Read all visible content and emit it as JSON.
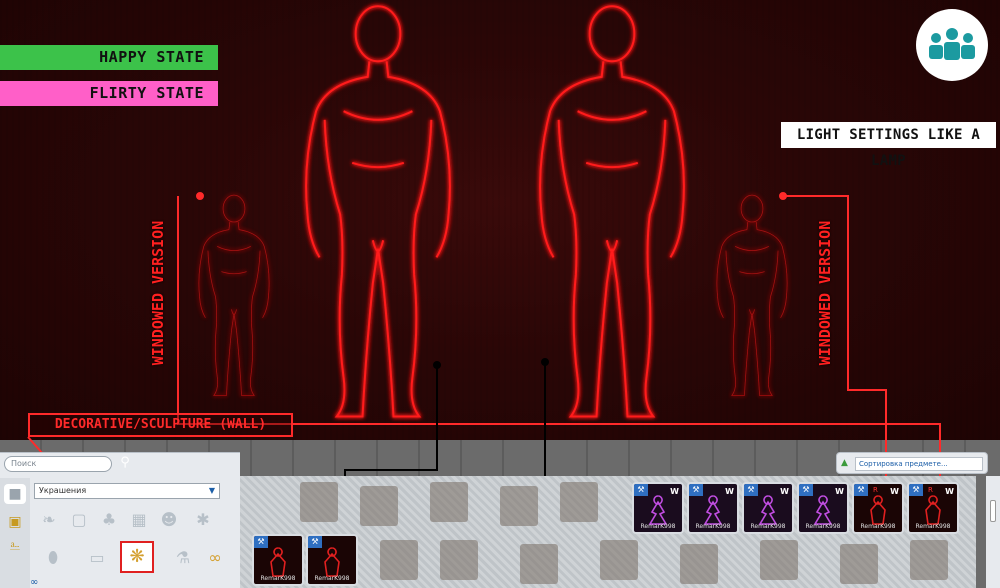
{
  "labels": {
    "happy": "HAPPY STATE",
    "flirty": "FLIRTY STATE",
    "light": "LIGHT SETTINGS LIKE A LAMP",
    "windowed_left": "WINDOWED VERSION",
    "windowed_right": "WINDOWED VERSION",
    "decorative": "DECORATIVE/SCULPTURE (WALL)"
  },
  "colors": {
    "happy": "#3cc24a",
    "flirty": "#ff5fc8",
    "neon": "#ff1a1a",
    "logo": "#1c9aa0"
  },
  "build_panel": {
    "search_placeholder": "Поиск",
    "search_icon": "search-icon",
    "category": "Украшения",
    "sort_placeholder": "Сортировка предмете...",
    "bottom_symbol": "∞"
  },
  "catalog_cards": [
    {
      "creator": "RemarK998",
      "tag": "W",
      "style": "purple"
    },
    {
      "creator": "RemarK998",
      "tag": "W",
      "style": "purple"
    },
    {
      "creator": "RemarK998",
      "tag": "W",
      "style": "purple"
    },
    {
      "creator": "RemarK998",
      "tag": "W",
      "style": "purple"
    },
    {
      "creator": "RemarK998",
      "tag": "W",
      "tagR": "R",
      "style": "red"
    },
    {
      "creator": "RemarK998",
      "tag": "W",
      "tagR": "R",
      "style": "red"
    },
    {
      "creator": "RemarK998",
      "style": "red"
    },
    {
      "creator": "RemarK998",
      "style": "red"
    }
  ]
}
